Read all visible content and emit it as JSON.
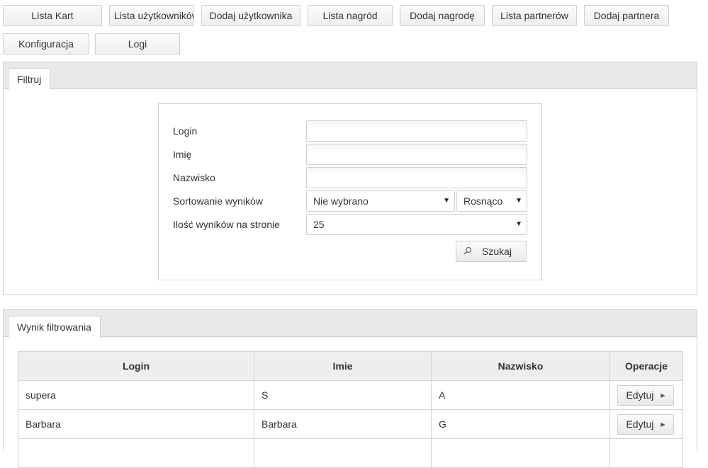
{
  "nav": {
    "buttons": [
      "Lista Kart",
      "Lista użytkowników",
      "Dodaj użytkownika",
      "Lista nagród",
      "Dodaj nagrodę",
      "Lista partnerów",
      "Dodaj partnera",
      "Konfiguracja",
      "Logi"
    ]
  },
  "filter": {
    "tab_label": "Filtruj",
    "login_label": "Login",
    "first_name_label": "Imię",
    "last_name_label": "Nazwisko",
    "sort_label": "Sortowanie wyników",
    "sort_field_value": "Nie wybrano",
    "sort_order_value": "Rosnąco",
    "per_page_label": "Ilość wyników na stronie",
    "per_page_value": "25",
    "search_label": "Szukaj",
    "search_icon": "search-icon"
  },
  "results": {
    "tab_label": "Wynik filtrowania",
    "columns": [
      "Login",
      "Imie",
      "Nazwisko",
      "Operacje"
    ],
    "rows": [
      {
        "login": "supera",
        "first_name": "S",
        "last_name": "A",
        "action": "Edytuj"
      },
      {
        "login": "Barbara",
        "first_name": "Barbara",
        "last_name": "G",
        "action": "Edytuj"
      }
    ],
    "action_icon": "caret-right-icon"
  }
}
